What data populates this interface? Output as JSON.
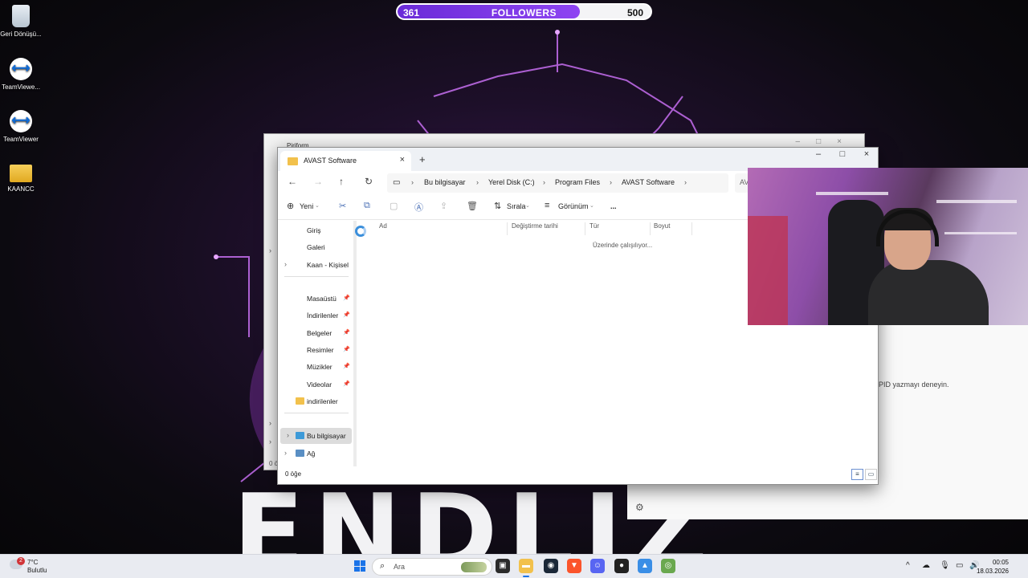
{
  "followers": {
    "current": "361",
    "label": "FOLLOWERS",
    "goal": "500",
    "progress_fraction": 0.722
  },
  "desktop_icons": [
    {
      "label": "Geri Dönüşü...",
      "icon": "recycle-bin-icon"
    },
    {
      "label": "TeamViewe...",
      "icon": "teamviewer-icon"
    },
    {
      "label": "TeamViewer",
      "icon": "teamviewer-icon"
    },
    {
      "label": "KAANCC",
      "icon": "folder-icon"
    }
  ],
  "back_window": {
    "title": "Piriform",
    "status": "0 ö"
  },
  "settings_window": {
    "message": "PID yazmayı deneyin."
  },
  "explorer": {
    "tab_title": "AVAST Software",
    "breadcrumb": [
      "Bu bilgisayar",
      "Yerel Disk (C:)",
      "Program Files",
      "AVAST Software"
    ],
    "search_hint": "AV",
    "toolbar": {
      "new_label": "Yeni",
      "sort_label": "Sırala",
      "view_label": "Görünüm",
      "more_label": "..."
    },
    "sidebar": {
      "top": [
        "Giriş",
        "Galeri",
        "Kaan - Kişisel"
      ],
      "pinned": [
        "Masaüstü",
        "İndirilenler",
        "Belgeler",
        "Resimler",
        "Müzikler",
        "Videolar",
        "indirilenler"
      ],
      "bottom": [
        "Bu bilgisayar",
        "Ağ"
      ]
    },
    "columns": [
      "Ad",
      "Değiştirme tarihi",
      "Tür",
      "Boyut"
    ],
    "working_text": "Üzerinde çalışılıyor...",
    "item_count": "0 öğe"
  },
  "taskbar": {
    "weather_temp": "7°C",
    "weather_cond": "Bulutlu",
    "weather_badge": "2",
    "search_placeholder": "Ara",
    "time": "00:05",
    "date": "18.03.2026"
  },
  "colors": {
    "accent": "#1a73e8",
    "followers_fill": "#7a35e6",
    "folder": "#f2c14c"
  }
}
